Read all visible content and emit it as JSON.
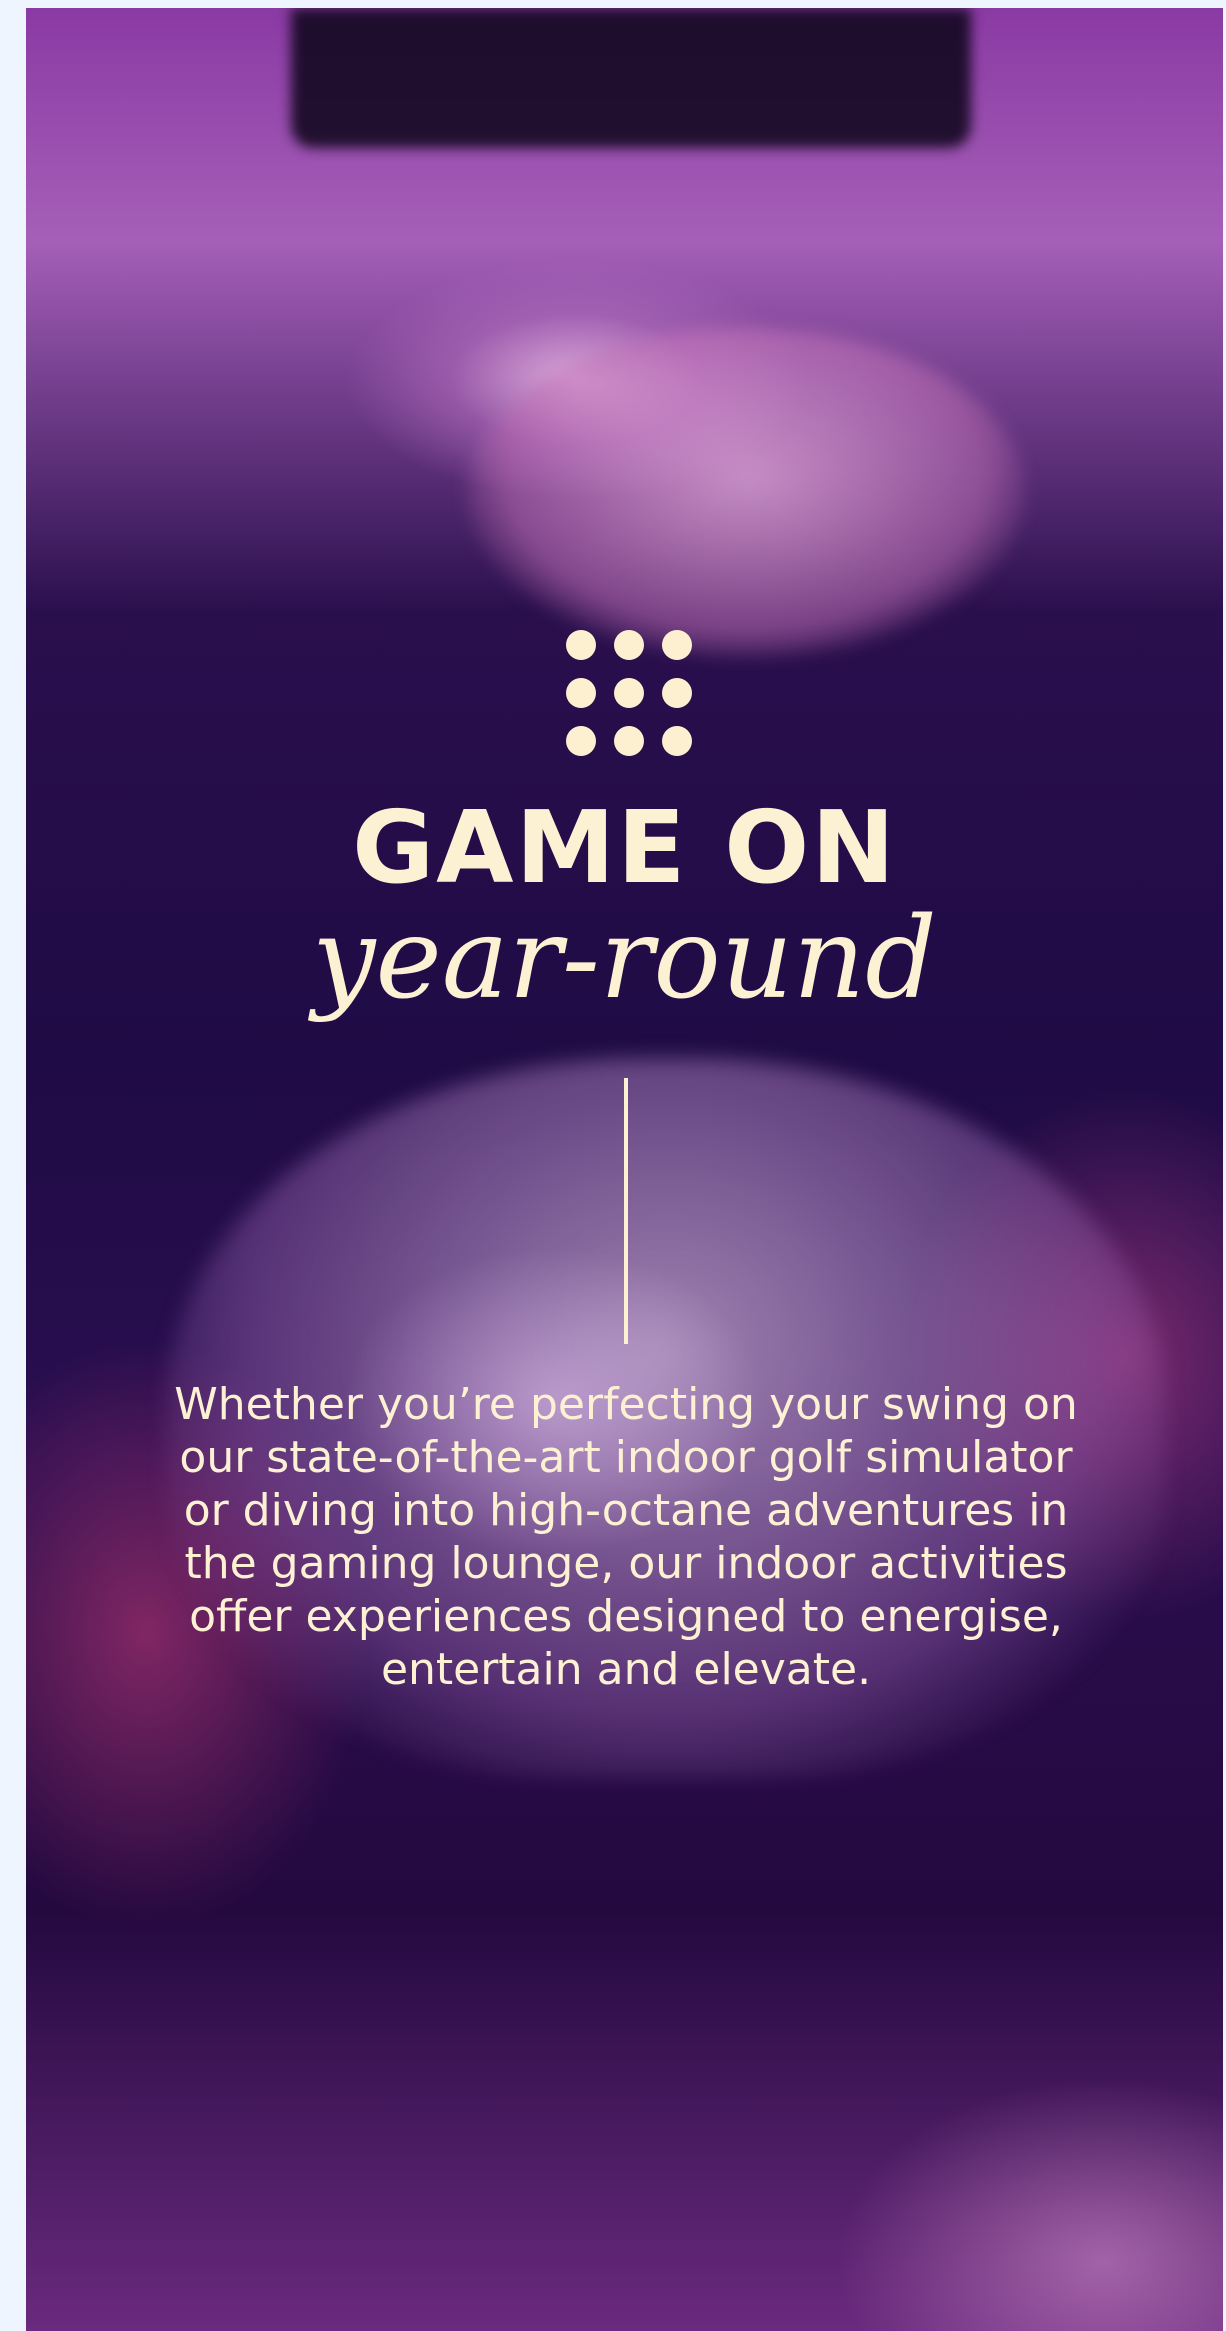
{
  "hero": {
    "title": "GAME ON",
    "subtitle": "year-round",
    "description": "Whether you’re perfecting your swing on our state-of-the-art indoor golf simulator or diving into high-octane adventures in the gaming lounge, our indoor activities offer experiences designed to energise, entertain and elevate."
  },
  "icons": {
    "logo": "nine-dot-grid-icon"
  },
  "colors": {
    "text": "#fdf1d3",
    "overlay": "#2a0f4d",
    "page_background": "#eef5ff"
  }
}
